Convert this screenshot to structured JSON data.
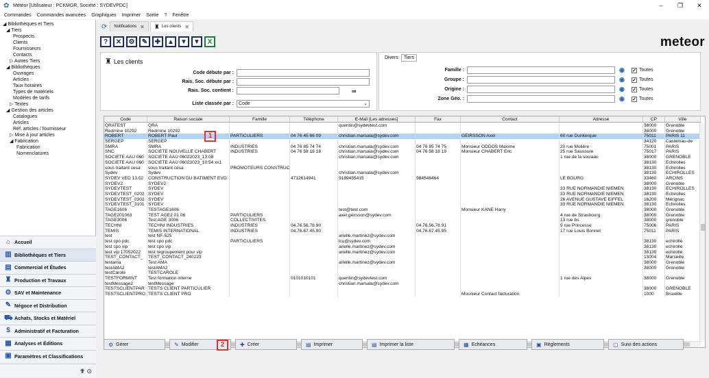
{
  "window": {
    "title": "Météor [Utilisateur : PCKMGR, Société : SYDEVPDC]",
    "controls": [
      "–",
      "❐",
      "✕"
    ]
  },
  "menubar": [
    "Commandes",
    "Commandes avancées",
    "Graphiques",
    "Imprimer",
    "Sortie",
    "?",
    "Fenêtre"
  ],
  "tree": [
    {
      "label": "◢ Bibliothèques et Tiers",
      "indent": 0
    },
    {
      "label": "◢ Tiers",
      "indent": 1
    },
    {
      "label": "Prospects",
      "indent": 3
    },
    {
      "label": "Clients",
      "indent": 3
    },
    {
      "label": "Fournisseurs",
      "indent": 3
    },
    {
      "label": "Contacts",
      "indent": 3
    },
    {
      "label": "▷ Autres Tiers",
      "indent": 2
    },
    {
      "label": "◢ Bibliothèques",
      "indent": 1
    },
    {
      "label": "Ouvrages",
      "indent": 3
    },
    {
      "label": "Articles",
      "indent": 3
    },
    {
      "label": "Taux horaires",
      "indent": 3
    },
    {
      "label": "Types de matériels",
      "indent": 3
    },
    {
      "label": "Modèles de tarifs",
      "indent": 3
    },
    {
      "label": "▷ Textes",
      "indent": 2
    },
    {
      "label": "◢ Gestion des articles",
      "indent": 1
    },
    {
      "label": "Catalogues",
      "indent": 3
    },
    {
      "label": "Articles",
      "indent": 3
    },
    {
      "label": "Réf. articles / fournisseur",
      "indent": 3
    },
    {
      "label": "▷ Mise à jour articles",
      "indent": 2
    },
    {
      "label": "◢ Fabrication",
      "indent": 2
    },
    {
      "label": "Fabrication",
      "indent": 4
    },
    {
      "label": "Nomenclatures",
      "indent": 4
    }
  ],
  "modules": [
    {
      "label": "Accueil",
      "icon": "home-icon",
      "glyph": "⌂"
    },
    {
      "label": "Bibliothèques et Tiers",
      "icon": "library-icon",
      "glyph": "▥",
      "active": true
    },
    {
      "label": "Commercial et Études",
      "icon": "commercial-icon",
      "glyph": "▤"
    },
    {
      "label": "Production et Travaux",
      "icon": "production-icon",
      "glyph": "♜"
    },
    {
      "label": "SAV et Maintenance",
      "icon": "sav-icon",
      "glyph": "⚙"
    },
    {
      "label": "Négoce et Distribution",
      "icon": "negoce-icon",
      "glyph": "✎"
    },
    {
      "label": "Achats, Stocks et Matériel",
      "icon": "achats-icon",
      "glyph": "⛟"
    },
    {
      "label": "Administratif et Facturation",
      "icon": "admin-icon",
      "glyph": "$"
    },
    {
      "label": "Analyses et Éditions",
      "icon": "analyses-icon",
      "glyph": "▦"
    },
    {
      "label": "Paramètres et Classifications",
      "icon": "params-icon",
      "glyph": "▣"
    }
  ],
  "tabs": [
    {
      "label": "Notifications"
    },
    {
      "label": "Les clients"
    }
  ],
  "toolbar": [
    {
      "name": "help-button",
      "glyph": "?"
    },
    {
      "name": "cancel-button",
      "glyph": "✕"
    },
    {
      "name": "settings-button",
      "glyph": "⚙"
    },
    {
      "name": "edit-button",
      "glyph": "✎"
    },
    {
      "name": "add-button",
      "glyph": "✚"
    },
    {
      "name": "move-up-button",
      "glyph": "▲"
    },
    {
      "name": "move-down-button",
      "glyph": "▼"
    },
    {
      "name": "filter-button",
      "glyph": "▼"
    },
    {
      "name": "excel-button",
      "glyph": "X"
    }
  ],
  "brand": "meteor",
  "filter": {
    "title": "Les clients",
    "code_label": "Code débute par :",
    "rais_label": "Rais. Soc. débute par :",
    "rais_contains_label": "Rais. Soc. contient :",
    "sort_label": "Liste classée par :",
    "sort_value": "Code"
  },
  "divers": {
    "tabs": [
      "Divers",
      "Tiers"
    ],
    "rows": [
      {
        "label": "Famille :",
        "all": "Toutes"
      },
      {
        "label": "Groupe :",
        "all": "Toutes"
      },
      {
        "label": "Origine :",
        "all": "Toutes"
      },
      {
        "label": "Zone Géo. :",
        "all": "Toutes"
      }
    ]
  },
  "columns": [
    "Code",
    "Raison sociale",
    "Famille",
    "Téléphone",
    "E-Mail [Les adresses]",
    "Fax",
    "Contact",
    "Adresse",
    "CP",
    "Ville"
  ],
  "rows": [
    [
      "QRATEST",
      "QRA",
      "",
      "",
      "quentin@sydevtest.com",
      "",
      "",
      "",
      "38000",
      "Grenoble"
    ],
    [
      "Redmine 10292",
      "Redmine 10292",
      "",
      "",
      "",
      "",
      "",
      "",
      "38000",
      "Grenoble"
    ],
    [
      "ROBERT",
      "ROBERT Paul",
      "PARTICULIERS",
      "04 76 45 66 09",
      "christian.marsala@sydev.com",
      "",
      "GEIRSSON Axel",
      "60 rue Dunkerque",
      "75011",
      "PARIS 11"
    ],
    [
      "SERGEP",
      "SERGEP",
      "",
      "",
      "",
      "",
      "",
      "",
      "34120",
      "Castelnau-de"
    ],
    [
      "SMRA",
      "SMRA",
      "INDUSTRIES",
      "04 76 85 74 74",
      "christian.marsala@sydev.com",
      "04 76 85 74 75",
      "Monsieur ODDOS Maxime",
      "20 rue Molière",
      "75001",
      "PARIS"
    ],
    [
      "SNC",
      "SOCIETE NOUVELLE CHABERT",
      "INDUSTRIES",
      "04 76 58 18 18",
      "christian.marsala@sydev.com",
      "04 76 58 18 19",
      "Monsieur CHABERT Eric",
      "25 rue Saussure",
      "75017",
      "PARIS"
    ],
    [
      "SOCIETE AAU 060",
      "SOCIETE AAU 06022023_13:08",
      "",
      "",
      "christian.marsala@sydev.com",
      "",
      "",
      "1 rue de la sociaau",
      "38000",
      "GRENOBLE"
    ],
    [
      "SOCIETE AAU 060",
      "SOCIETE AAU 06022023_10:54 xx1",
      "",
      "",
      "",
      "",
      "",
      "",
      "38130",
      "Échirolles"
    ],
    [
      "sous traitant cesa",
      "sous traitant cesa",
      "PROMOTEURS CONSTRUCT",
      "",
      "",
      "",
      "",
      "",
      "38130",
      "Échirolles"
    ],
    [
      "Sydev",
      "Sydev",
      "",
      "",
      "christian.marsala@sydev.com",
      "",
      "",
      "",
      "38130",
      "ECHIROLLES"
    ],
    [
      "SYDEV VED 13.02",
      "CONSTRUCTION DU BATIMENT EVO",
      "",
      "4712614941",
      "9189455415",
      "984546464",
      "",
      "LE BOURG",
      "33460",
      "ARCINS"
    ],
    [
      "SYDEV2",
      "SYDEV2",
      "",
      "",
      "",
      "",
      "",
      "",
      "38000",
      "Grenoble"
    ],
    [
      "SYDEVTEST",
      "SYDEV",
      "",
      "",
      "",
      "",
      "",
      "33 RUE NORMANDIE NIEMEN",
      "38130",
      "ECHIROLLES"
    ],
    [
      "SYDEVTEST_0202",
      "SYDEV",
      "",
      "",
      "",
      "",
      "",
      "33 RUE NORMANDIE NIEMEN",
      "38130",
      "Échirolles"
    ],
    [
      "SYDEVTEST_0302",
      "SYDEV",
      "",
      "",
      "",
      "",
      "",
      "26 AVENUE GUSTAVE EIFFEL",
      "16200",
      "Mérignac"
    ],
    [
      "SYDEVTEST_3101",
      "SYDEV",
      "",
      "",
      "",
      "",
      "",
      "33 RUE NORMANDIE NIEMEN",
      "38130",
      "Échirolles"
    ],
    [
      "TAGE1606",
      "TESTAGE1606",
      "",
      "",
      "test@test.com",
      "",
      "Monsieur KANE Harry",
      "",
      "38000",
      "Grenoble"
    ],
    [
      "TAGE201063",
      "TEST AGE2 01 06",
      "PARTICULIERS",
      "",
      "axel.geirsson@sydev.com",
      "",
      "",
      "4 rue de Strasbourg",
      "38000",
      "Grenoble"
    ],
    [
      "TAGE3006",
      "Test AGE 3006",
      "COLLECTIVITES",
      "",
      "",
      "",
      "",
      "13 rue bs",
      "38000",
      "grenoble"
    ],
    [
      "TECHNI",
      "TECHNI INDUSTRIES",
      "INDUSTRIES",
      "04.76.56.78.90",
      "",
      "04.76.56.78.91",
      "",
      "9 rue Princesse",
      "75006",
      "PARIS"
    ],
    [
      "TEMIS",
      "TEMIS INTERNATIONAL",
      "INDUSTRIES",
      "04.76.67.45.90",
      "",
      "04.76.67.45.95",
      "",
      "17 rue Louis Bonnet",
      "75011",
      "PARIS"
    ],
    [
      "test",
      "test NF-525",
      "",
      "",
      "arielle.martinez@sydev.com",
      "",
      "",
      "",
      "",
      ""
    ],
    [
      "test cpo pdc",
      "test cpo pdc",
      "PARTICULIERS",
      "",
      "lcu@sydev.com",
      "",
      "",
      "",
      "38130",
      "echirolle"
    ],
    [
      "test cpo vip",
      "test cpo vip",
      "",
      "",
      "arielle.martinez@sydev.com",
      "",
      "",
      "",
      "38130",
      "echirolle"
    ],
    [
      "test vip 17052022",
      "test regroupement pour vip",
      "",
      "",
      "arielle.martinez@sydev.com",
      "",
      "",
      "",
      "38130",
      "echirolle"
    ],
    [
      "TEST_CONTACT_",
      "TEST_CONTACT_240223",
      "",
      "",
      "",
      "",
      "",
      "",
      "13004",
      "Marseille"
    ],
    [
      "testama",
      "Test AMA",
      "",
      "",
      "arielle.martinez@sydev.com",
      "",
      "",
      "",
      "38000",
      "Grenoble"
    ],
    [
      "testAMA2",
      "testAMA2",
      "",
      "",
      "",
      "",
      "",
      "",
      "38000",
      "Grenoble"
    ],
    [
      "testCarole",
      "TESTCAROLE",
      "",
      "",
      "",
      "",
      "",
      "",
      "",
      ""
    ],
    [
      "TESTFORMINT",
      "Test formation interne",
      "",
      "0101010101",
      "quentin@sydevtest.com",
      "",
      "",
      "1 rue des Alpes",
      "38000",
      "Grenoble"
    ],
    [
      "testMessage2",
      "testMessage",
      "",
      "",
      "christian.marsala@sydev.com",
      "",
      "",
      "",
      "",
      ""
    ],
    [
      "TESTSCLIENTPAR",
      "TESTS CLIENT PARTICULIER",
      "",
      "",
      "",
      "",
      "",
      "",
      "38000",
      "GRENOBLE"
    ],
    [
      "TESTSCLIENTPRO",
      "TESTS CLIENT PRO",
      "",
      "",
      "",
      "",
      "Mosnieur Contact facturation",
      "",
      "1000",
      "Bruxelle"
    ]
  ],
  "selected_row": 2,
  "markers": [
    "1",
    "2"
  ],
  "buttons": [
    {
      "label": "Gérer",
      "icon": "manage-icon",
      "glyph": "⚙",
      "w": 90
    },
    {
      "label": "Modifier",
      "icon": "edit-icon",
      "glyph": "✎",
      "w": 90
    },
    {
      "label": "Créer",
      "icon": "create-icon",
      "glyph": "✚",
      "w": 90
    },
    {
      "label": "Imprimer",
      "icon": "print-icon",
      "glyph": "▤",
      "w": 90
    },
    {
      "label": "Imprimer la liste",
      "icon": "print-list-icon",
      "glyph": "▤",
      "w": 128
    },
    {
      "label": "Echéances",
      "icon": "calendar-icon",
      "glyph": "▦",
      "w": 100
    },
    {
      "label": "Règlements",
      "icon": "payments-icon",
      "glyph": "▣",
      "w": 106
    },
    {
      "label": "Suivi des actions",
      "icon": "actions-icon",
      "glyph": "▢",
      "w": 110
    }
  ]
}
